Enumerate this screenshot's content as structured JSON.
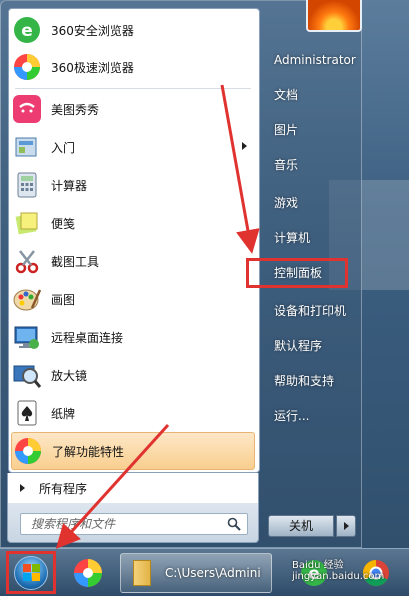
{
  "start_menu": {
    "programs": [
      {
        "label": "360安全浏览器",
        "icon": "360-safe-browser-icon"
      },
      {
        "label": "360极速浏览器",
        "icon": "360-speed-browser-icon"
      },
      {
        "label": "美图秀秀",
        "icon": "meitu-icon"
      },
      {
        "label": "入门",
        "icon": "getting-started-icon"
      },
      {
        "label": "计算器",
        "icon": "calculator-icon"
      },
      {
        "label": "便笺",
        "icon": "sticky-notes-icon"
      },
      {
        "label": "截图工具",
        "icon": "snipping-tool-icon"
      },
      {
        "label": "画图",
        "icon": "paint-icon"
      },
      {
        "label": "远程桌面连接",
        "icon": "remote-desktop-icon"
      },
      {
        "label": "放大镜",
        "icon": "magnifier-icon"
      },
      {
        "label": "纸牌",
        "icon": "solitaire-icon"
      },
      {
        "label": "了解功能特性",
        "icon": "features-icon"
      }
    ],
    "all_programs": "所有程序",
    "search_placeholder": "搜索程序和文件",
    "right_items": [
      "Administrator",
      "文档",
      "图片",
      "音乐",
      "游戏",
      "计算机",
      "控制面板",
      "设备和打印机",
      "默认程序",
      "帮助和支持",
      "运行..."
    ],
    "shutdown_label": "关机"
  },
  "taskbar": {
    "explorer_label": "C:\\Users\\Admini",
    "watermark": "Baidu 经验 jingyan.baidu.com"
  },
  "colors": {
    "highlight_border": "#e0322f",
    "annotation_arrow": "#e0322f"
  }
}
